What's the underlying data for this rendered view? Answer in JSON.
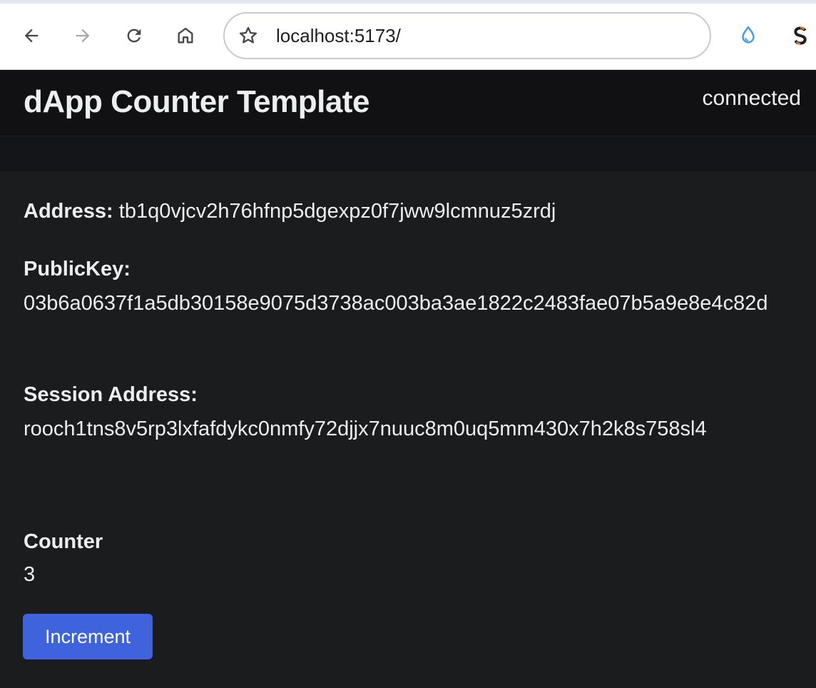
{
  "browser": {
    "url": "localhost:5173/",
    "icons": [
      "back-icon",
      "forward-icon",
      "reload-icon",
      "home-icon",
      "bookmark-star-icon",
      "droplet-extension-icon",
      "s-extension-icon"
    ]
  },
  "app": {
    "title": "dApp Counter Template",
    "connection_status": "connected"
  },
  "account": {
    "address_label": "Address:",
    "address_value": "tb1q0vjcv2h76hfnp5dgexpz0f7jww9lcmnuz5zrdj",
    "public_key_label": "PublicKey:",
    "public_key_value": "03b6a0637f1a5db30158e9075d3738ac003ba3ae1822c2483fae07b5a9e8e4c82d",
    "session_address_label": "Session Address:",
    "session_address_value": "rooch1tns8v5rp3lxfafdykc0nmfy72djjx7nuuc8m0uq5mm430x7h2k8s758sl4"
  },
  "counter": {
    "label": "Counter",
    "value": "3",
    "increment_label": "Increment"
  },
  "colors": {
    "accent": "#3e63dd",
    "background": "#1b1c1e",
    "header": "#111113"
  }
}
